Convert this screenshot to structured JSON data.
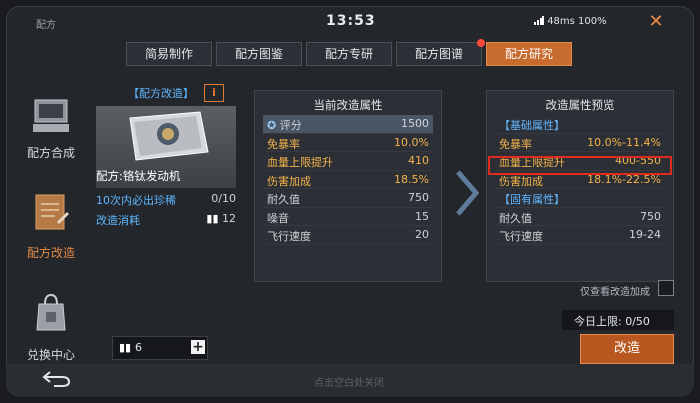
{
  "header": {
    "window_title": "配方",
    "clock": "13:53",
    "status": "48ms 100%"
  },
  "tabs": [
    {
      "label": "简易制作",
      "active": false
    },
    {
      "label": "配方图鉴",
      "active": false
    },
    {
      "label": "配方专研",
      "active": false
    },
    {
      "label": "配方图谱",
      "active": false,
      "dot": true
    },
    {
      "label": "配方研究",
      "active": true
    }
  ],
  "sidebar": {
    "items": [
      {
        "label": "配方合成",
        "icon": "terminal-icon"
      },
      {
        "label": "配方改造",
        "icon": "blueprint-icon",
        "active": true
      },
      {
        "label": "兑换中心",
        "icon": "bag-icon"
      }
    ]
  },
  "left_card": {
    "header": "【配方改造】",
    "info": "i",
    "item_name": "配方:铬钛发动机",
    "guarantee_label": "10次内必出珍稀",
    "guarantee_value": "0/10",
    "cost_label": "改造消耗",
    "cost_value": "12",
    "stepper_value": "6"
  },
  "current": {
    "title": "当前改造属性",
    "rows": [
      {
        "k": "评分",
        "v": "1500",
        "hl": true
      },
      {
        "k": "免暴率",
        "v": "10.0%",
        "o": true
      },
      {
        "k": "血量上限提升",
        "v": "410",
        "o": true
      },
      {
        "k": "伤害加成",
        "v": "18.5%",
        "o": true
      },
      {
        "k": "耐久值",
        "v": "750"
      },
      {
        "k": "噪音",
        "v": "15"
      },
      {
        "k": "飞行速度",
        "v": "20"
      }
    ]
  },
  "preview": {
    "title": "改造属性预览",
    "rows": [
      {
        "k": "【基础属性】",
        "v": "",
        "section": true
      },
      {
        "k": "免暴率",
        "v": "10.0%-11.4%",
        "o": true
      },
      {
        "k": "血量上限提升",
        "v": "400-550",
        "o": true
      },
      {
        "k": "伤害加成",
        "v": "18.1%-22.5%",
        "o": true
      },
      {
        "k": "【固有属性】",
        "v": "",
        "section": true
      },
      {
        "k": "耐久值",
        "v": "750"
      },
      {
        "k": "飞行速度",
        "v": "19-24"
      }
    ]
  },
  "only_modified": "仅查看改造加成",
  "daily_limit": "今日上限: 0/50",
  "modify_button": "改造",
  "hint": "点击空白处关闭",
  "colors": {
    "accent": "#c86b2e",
    "highlight": "#e22b1f",
    "value": "#f3b24a",
    "link": "#5fb6ff"
  }
}
